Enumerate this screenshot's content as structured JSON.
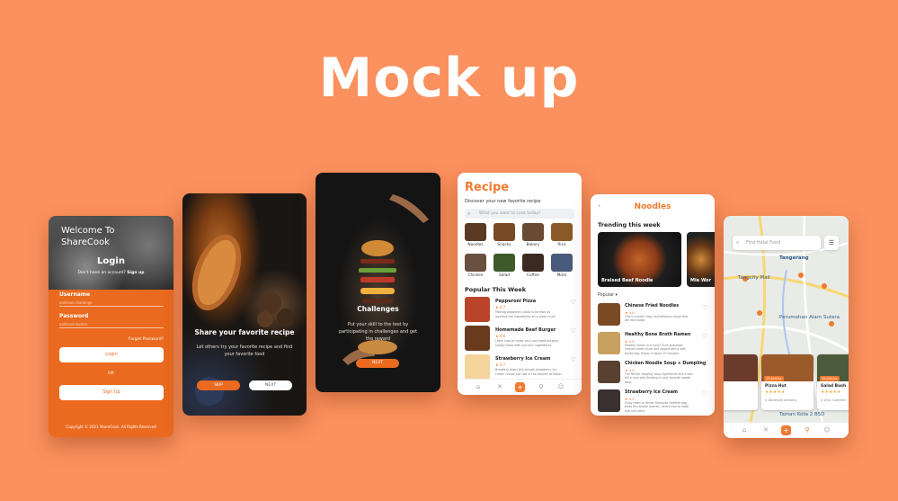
{
  "headline": "Mock up",
  "login": {
    "title": "Welcome To ShareCook",
    "heading": "Login",
    "signup_prompt": "Don't have an account?",
    "signup_link": "Sign up",
    "username_label": "Username",
    "username_value": "andreas.challenge",
    "password_label": "Password",
    "password_value": "andreasnavarro",
    "forgot": "Forget Password?",
    "login_button": "Login",
    "or": "OR",
    "signup_button": "Sign Up",
    "copyright": "Copyright © 2021 ShareCook. All Rights Reserved"
  },
  "onboard1": {
    "heading": "Share your favorite recipe",
    "text": "Let others try your favorite recipe and find your favorite food",
    "skip": "SKIP",
    "next": "NEXT"
  },
  "onboard2": {
    "heading": "Challenges",
    "text": "Put your skill to the test by participating in challenges and get the reward",
    "next": "NEXT"
  },
  "recipe": {
    "title": "Recipe",
    "subtitle": "Discover your new favorite recipe",
    "search_placeholder": "What you want to cook today?",
    "categories": [
      {
        "label": "Noodles",
        "color": "#5a3a22"
      },
      {
        "label": "Snacks",
        "color": "#7a4a24"
      },
      {
        "label": "Bakery",
        "color": "#6a4a30"
      },
      {
        "label": "Rice",
        "color": "#8a5a2a"
      },
      {
        "label": "Chicken",
        "color": "#6a5040"
      },
      {
        "label": "Salad",
        "color": "#3e5a2a"
      },
      {
        "label": "Coffee",
        "color": "#3a2a22"
      },
      {
        "label": "More",
        "color": "#4a5a7a"
      }
    ],
    "popular_title": "Popular This Week",
    "items": [
      {
        "name": "Pepperoni Pizza",
        "rating": "★ 4.7",
        "desc": "Making pepperoni pizza is as easy as layering the ingredients on a pizza crust",
        "color": "#b9442a"
      },
      {
        "name": "Homemade Beef Burger",
        "rating": "★ 4.6",
        "desc": "Learn how to make your own beef burgers, simply done with just four ingredients",
        "color": "#6a3a1e"
      },
      {
        "name": "Strawberry Ice Cream",
        "rating": "★ 4.7",
        "desc": "Breaking down this simple strawberry ice cream recipe just like in the kitchen of Ralph",
        "color": "#f4d49a"
      }
    ]
  },
  "noodles": {
    "title": "Noodles",
    "trending_title": "Trending this week",
    "trending": [
      "Braised Beef Noodle",
      "Mie Wor"
    ],
    "sort": "Popular",
    "items": [
      {
        "name": "Chinese Fried Noodles",
        "rating": "★ 4.8",
        "desc": "This is a quick, easy and delicious recipe that will rock today",
        "color": "#7a4a24"
      },
      {
        "name": "Healthy Bone Broth Ramen",
        "rating": "★ 4.5",
        "desc": "Healthy ramen in a hurry? Sure-seasoned chicken broth chunk and topped with a soft-boiled egg. Ready in about 20 minutes",
        "color": "#c8a060"
      },
      {
        "name": "Chicken Noodle Soup + Dumpling",
        "rating": "★ 4.9",
        "desc": "The Perfect 'dipping' soup ingredients and a won fell in love with Braising in your favorite noodle soup",
        "color": "#5a4030"
      },
      {
        "name": "Strawberry Ice Cream",
        "rating": "★ 4.5",
        "desc": "Enjoy heart or dinner flavoured certified egg tasks this simple layered. Here's how to make that call home",
        "color": "#3a3030"
      }
    ]
  },
  "map": {
    "search_placeholder": "Find Halal Food",
    "labels": [
      "Tangerang",
      "Tangcity Mall",
      "Perumahan Alam Sutera",
      "Taman Kota 2 BSD"
    ],
    "cards": [
      {
        "name": "",
        "badge": "",
        "color": "#6a3a2a"
      },
      {
        "name": "Pizza Hut",
        "badge": "25-40mins",
        "stars": "★★★★★",
        "address": "Jl. Boulevard Jombang",
        "color": "#9a5a2a"
      },
      {
        "name": "Salad Bush",
        "badge": "20-40mins",
        "stars": "★★★★★",
        "address": "Jl. Jend. Sudirman",
        "color": "#4a5a3a"
      }
    ]
  },
  "colors": {
    "accent": "#f07a30",
    "background": "#fb915e",
    "login_bg": "#ea6a1f"
  }
}
